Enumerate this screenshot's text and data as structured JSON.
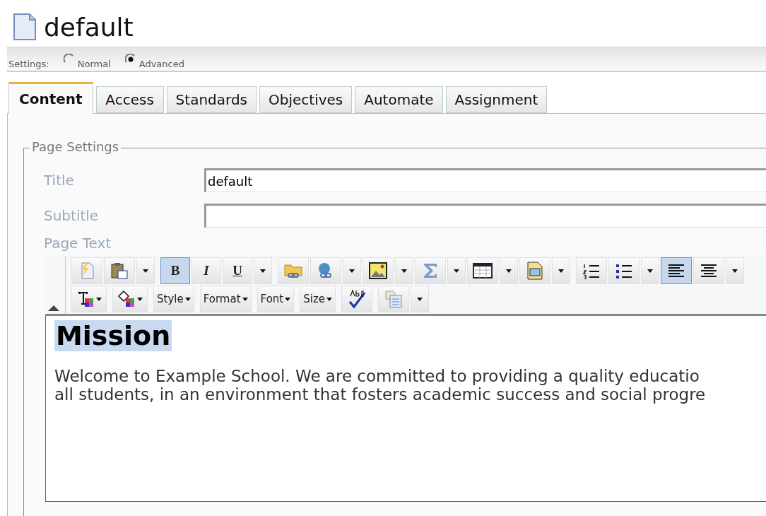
{
  "page": {
    "title": "default"
  },
  "settings": {
    "label": "Settings:",
    "options": [
      {
        "label": "Normal",
        "selected": false
      },
      {
        "label": "Advanced",
        "selected": true
      }
    ]
  },
  "tabs": [
    {
      "label": "Content",
      "selected": true
    },
    {
      "label": "Access",
      "selected": false
    },
    {
      "label": "Standards",
      "selected": false
    },
    {
      "label": "Objectives",
      "selected": false
    },
    {
      "label": "Automate",
      "selected": false
    },
    {
      "label": "Assignment",
      "selected": false
    }
  ],
  "page_settings": {
    "legend": "Page Settings",
    "fields": [
      {
        "label": "Title",
        "value": "default"
      },
      {
        "label": "Subtitle"
      }
    ],
    "page_text_label": "Page Text"
  },
  "toolbar": {
    "rows": [
      [
        [
          {
            "kind": "icon"
          },
          {
            "kind": "icon"
          },
          {
            "kind": "arrow"
          }
        ],
        [
          {
            "kind": "letter",
            "label": "B",
            "active": true
          },
          {
            "kind": "letter",
            "label": "I",
            "active": false
          },
          {
            "kind": "letter",
            "label": "U",
            "active": false
          },
          {
            "kind": "arrow"
          }
        ],
        [
          {
            "kind": "icon"
          },
          {
            "kind": "icon"
          },
          {
            "kind": "arrow"
          },
          {
            "kind": "icon"
          },
          {
            "kind": "arrow"
          },
          {
            "kind": "icon"
          },
          {
            "kind": "arrow"
          },
          {
            "kind": "icon"
          },
          {
            "kind": "arrow"
          },
          {
            "kind": "icon"
          },
          {
            "kind": "arrow"
          }
        ],
        [
          {
            "kind": "icon"
          },
          {
            "kind": "icon"
          },
          {
            "kind": "arrow"
          },
          {
            "kind": "icon",
            "active": true
          },
          {
            "kind": "icon",
            "active": false
          },
          {
            "kind": "arrow"
          }
        ]
      ],
      [
        [
          {
            "kind": "icon-menu"
          }
        ],
        [
          {
            "kind": "icon-menu"
          }
        ],
        [
          {
            "kind": "menu",
            "label": "Style"
          }
        ],
        [
          {
            "kind": "menu",
            "label": "Format"
          }
        ],
        [
          {
            "kind": "menu",
            "label": "Font"
          }
        ],
        [
          {
            "kind": "menu",
            "label": "Size"
          }
        ],
        [
          {
            "kind": "icon"
          }
        ],
        [
          {
            "kind": "icon"
          },
          {
            "kind": "arrow"
          }
        ]
      ]
    ]
  },
  "editor": {
    "heading": "Mission",
    "heading_selected": true,
    "lines": [
      "Welcome to Example School. We are committed to providing a quality educatio",
      "all students, in an environment that fosters academic success and social progre"
    ]
  }
}
